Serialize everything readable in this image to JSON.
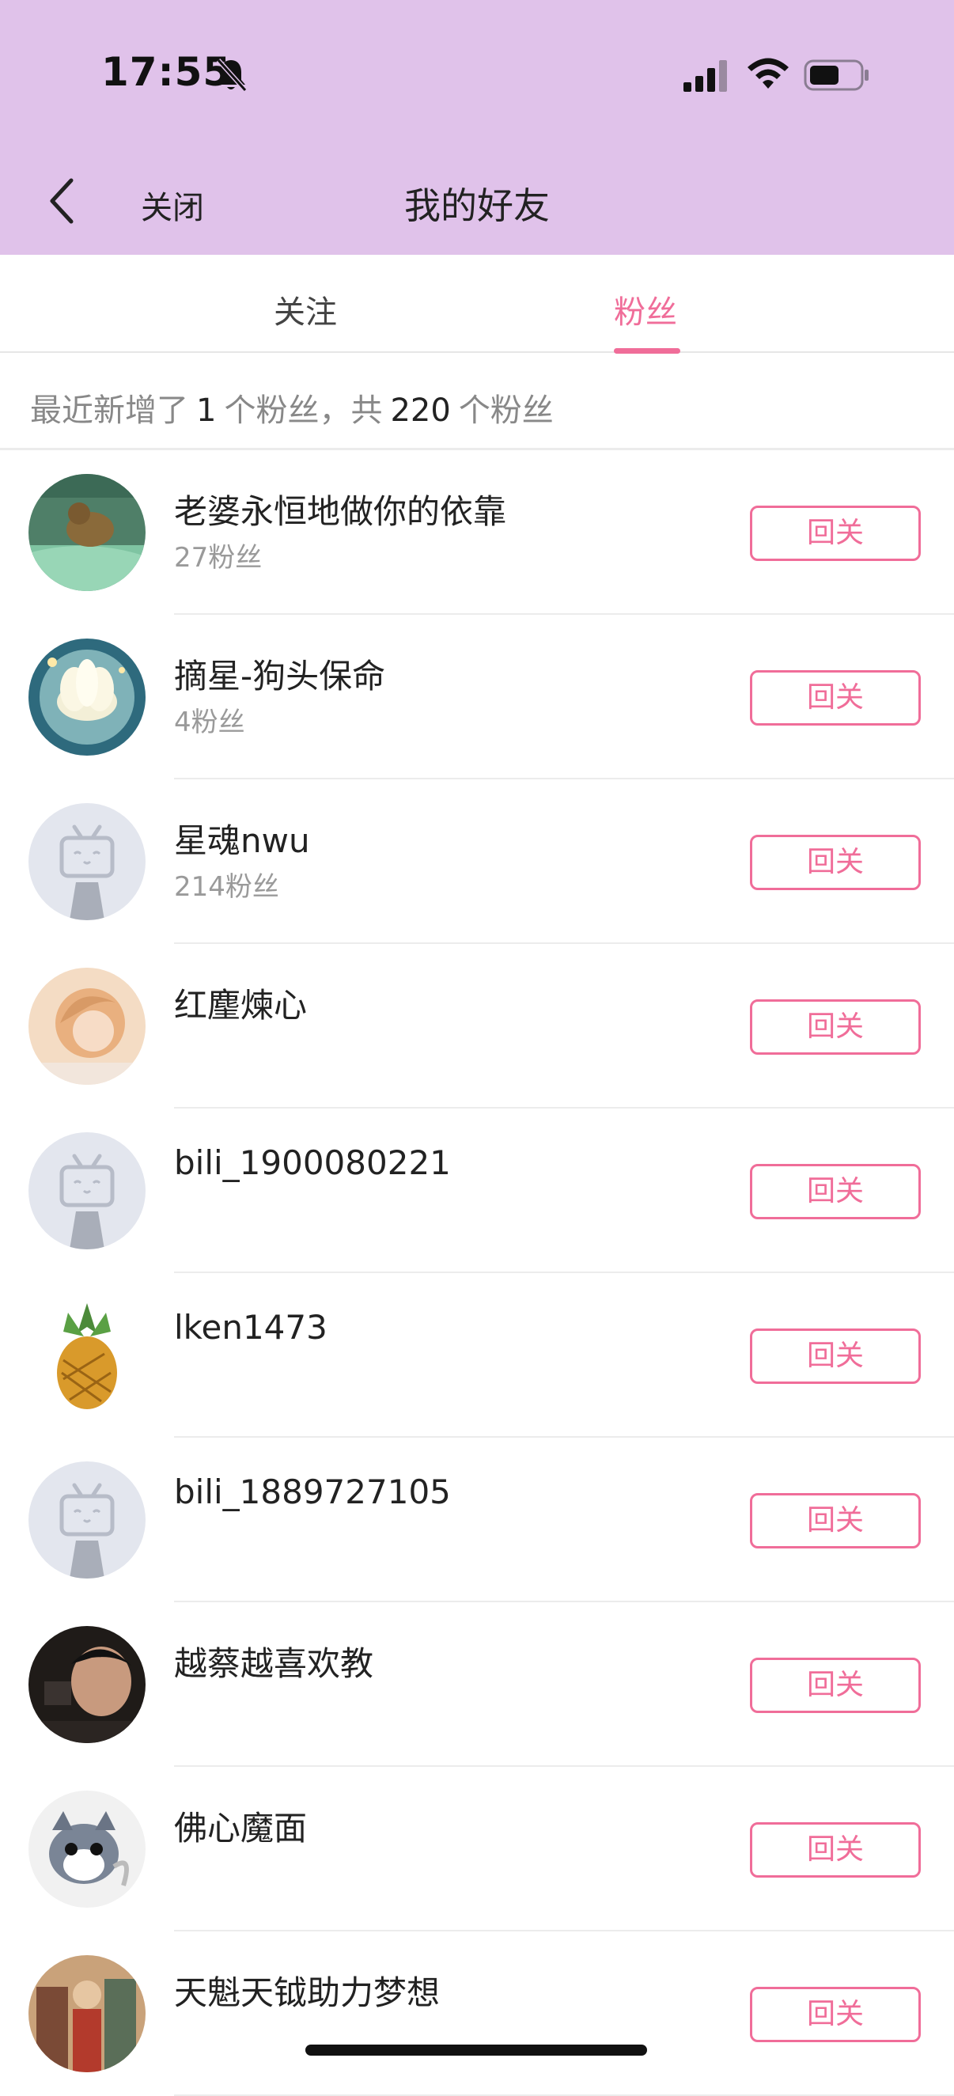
{
  "status_bar": {
    "time": "17:55"
  },
  "nav": {
    "close_label": "关闭",
    "title": "我的好友"
  },
  "tabs": [
    {
      "label": "关注",
      "active": false
    },
    {
      "label": "粉丝",
      "active": true
    }
  ],
  "summary": {
    "prefix": "最近新增了",
    "new_count": "1",
    "middle": "个粉丝，共",
    "total_count": "220",
    "suffix": "个粉丝"
  },
  "colors": {
    "header_bg": "#e0c2ea",
    "accent": "#f06d99"
  },
  "follow_back_label": "回关",
  "fans": [
    {
      "name": "老婆永恒地做你的依靠",
      "fans": "27粉丝",
      "avatar": "photo-otter"
    },
    {
      "name": "摘星-狗头保命",
      "fans": "4粉丝",
      "avatar": "photo-lotus"
    },
    {
      "name": "星魂nwu",
      "fans": "214粉丝",
      "avatar": "default-tv"
    },
    {
      "name": "红麈煉心",
      "fans": "",
      "avatar": "photo-girl"
    },
    {
      "name": "bili_1900080221",
      "fans": "",
      "avatar": "default-tv"
    },
    {
      "name": "lken1473",
      "fans": "",
      "avatar": "photo-pineapple"
    },
    {
      "name": "bili_1889727105",
      "fans": "",
      "avatar": "default-tv"
    },
    {
      "name": "越蔡越喜欢教",
      "fans": "",
      "avatar": "photo-man"
    },
    {
      "name": "佛心魔面",
      "fans": "",
      "avatar": "photo-cat"
    },
    {
      "name": "天魁天钺助力梦想",
      "fans": "",
      "avatar": "photo-painting"
    }
  ]
}
